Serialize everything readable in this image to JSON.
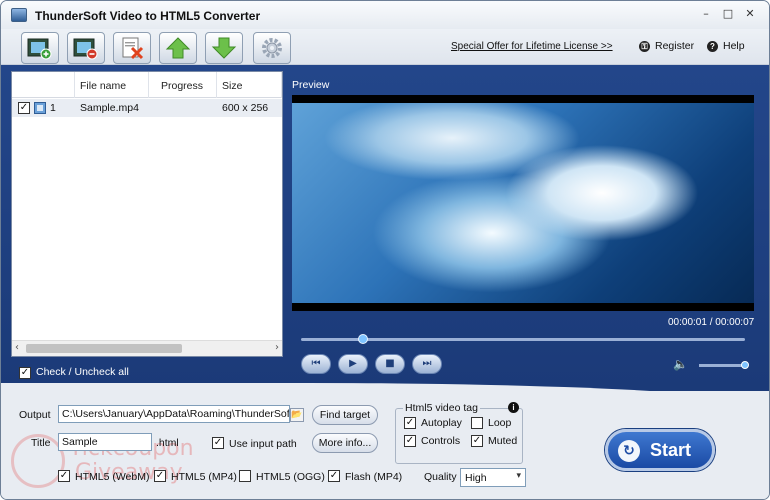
{
  "window": {
    "title": "ThunderSoft Video to HTML5 Converter",
    "minimize": "–",
    "maximize": "□",
    "close": "✕"
  },
  "toolbar": {
    "buttons": [
      "add-video-icon",
      "remove-video-icon",
      "clear-list-icon",
      "move-up-icon",
      "move-down-icon",
      "settings-icon"
    ],
    "special_offer": "Special Offer for Lifetime License >>",
    "register": "Register",
    "help": "Help"
  },
  "file_list": {
    "columns": [
      "File name",
      "Progress",
      "Size"
    ],
    "rows": [
      {
        "checked": true,
        "index": "1",
        "name": "Sample.mp4",
        "progress": "",
        "size": "600 x 256"
      }
    ],
    "check_all": "Check / Uncheck all"
  },
  "preview": {
    "label": "Preview",
    "timecode": "00:00:01 / 00:00:07",
    "seek_fraction": 0.14,
    "volume_fraction": 1.0
  },
  "output": {
    "output_label": "Output",
    "output_path": "C:\\Users\\January\\AppData\\Roaming\\ThunderSoft\\V",
    "find_target": "Find target",
    "title_label": "Title",
    "title_value": "Sample",
    "title_ext": ".html",
    "use_input_path": "Use input path",
    "more_info": "More info...",
    "formats": [
      {
        "label": "HTML5 (WebM)",
        "checked": true
      },
      {
        "label": "HTML5 (MP4)",
        "checked": true
      },
      {
        "label": "HTML5 (OGG)",
        "checked": false
      },
      {
        "label": "Flash (MP4)",
        "checked": true
      }
    ],
    "quality_label": "Quality",
    "quality_value": "High"
  },
  "html5_tag": {
    "title": "Html5 video tag",
    "autoplay": "Autoplay",
    "loop": "Loop",
    "controls": "Controls",
    "muted": "Muted"
  },
  "start_label": "Start",
  "watermark": {
    "line1": "Tickcoupon",
    "line2": "Giveaway"
  }
}
